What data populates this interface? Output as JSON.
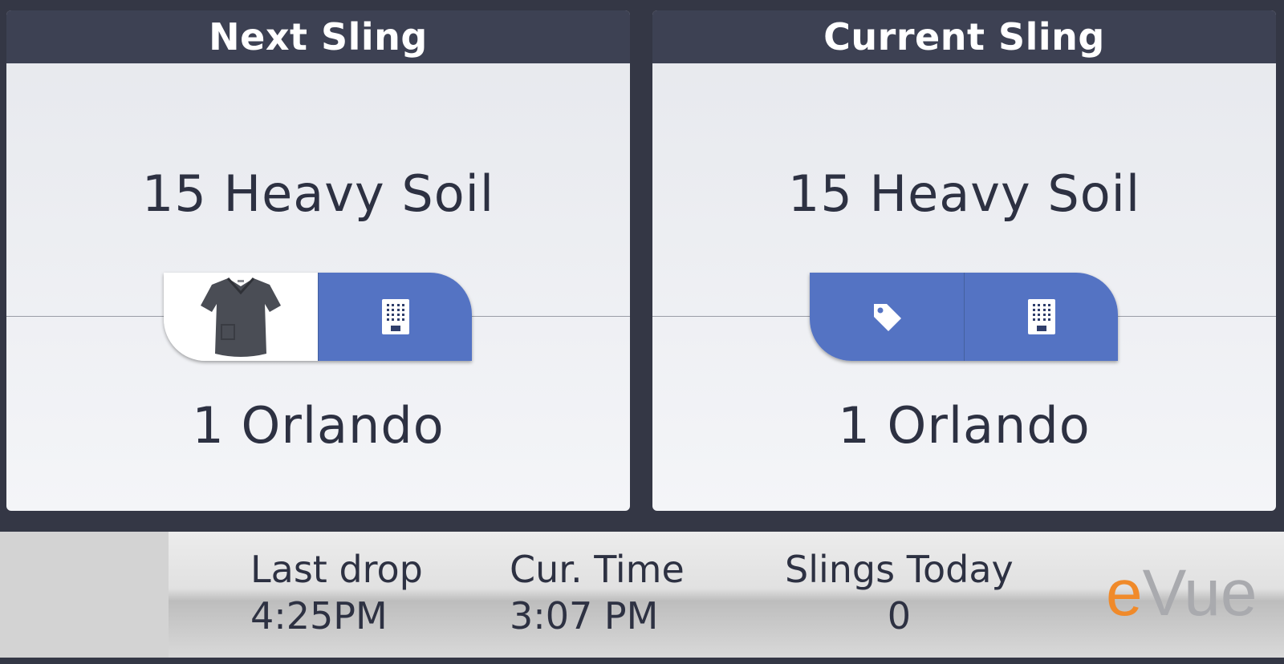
{
  "next_sling": {
    "header": "Next Sling",
    "product": "15 Heavy Soil",
    "customer": "1 Orlando",
    "tiles": [
      {
        "kind": "product-image",
        "icon": "scrub-shirt-image"
      },
      {
        "kind": "button",
        "icon": "building-icon"
      }
    ]
  },
  "current_sling": {
    "header": "Current Sling",
    "product": "15 Heavy Soil",
    "customer": "1 Orlando",
    "tiles": [
      {
        "kind": "button",
        "icon": "tag-icon"
      },
      {
        "kind": "button",
        "icon": "building-icon"
      }
    ]
  },
  "status_bar": {
    "last_drop_label": "Last drop",
    "last_drop_value": "4:25PM",
    "cur_time_label": "Cur. Time",
    "cur_time_value": "3:07 PM",
    "slings_today_label": "Slings Today",
    "slings_today_value": "0"
  },
  "logo": {
    "e": "e",
    "rest": "Vue"
  },
  "colors": {
    "background": "#343745",
    "header": "#3d4153",
    "tile_blue": "#5473c3",
    "text": "#2d3142",
    "logo_orange": "#f08a2a",
    "logo_gray": "#a9aaae"
  }
}
